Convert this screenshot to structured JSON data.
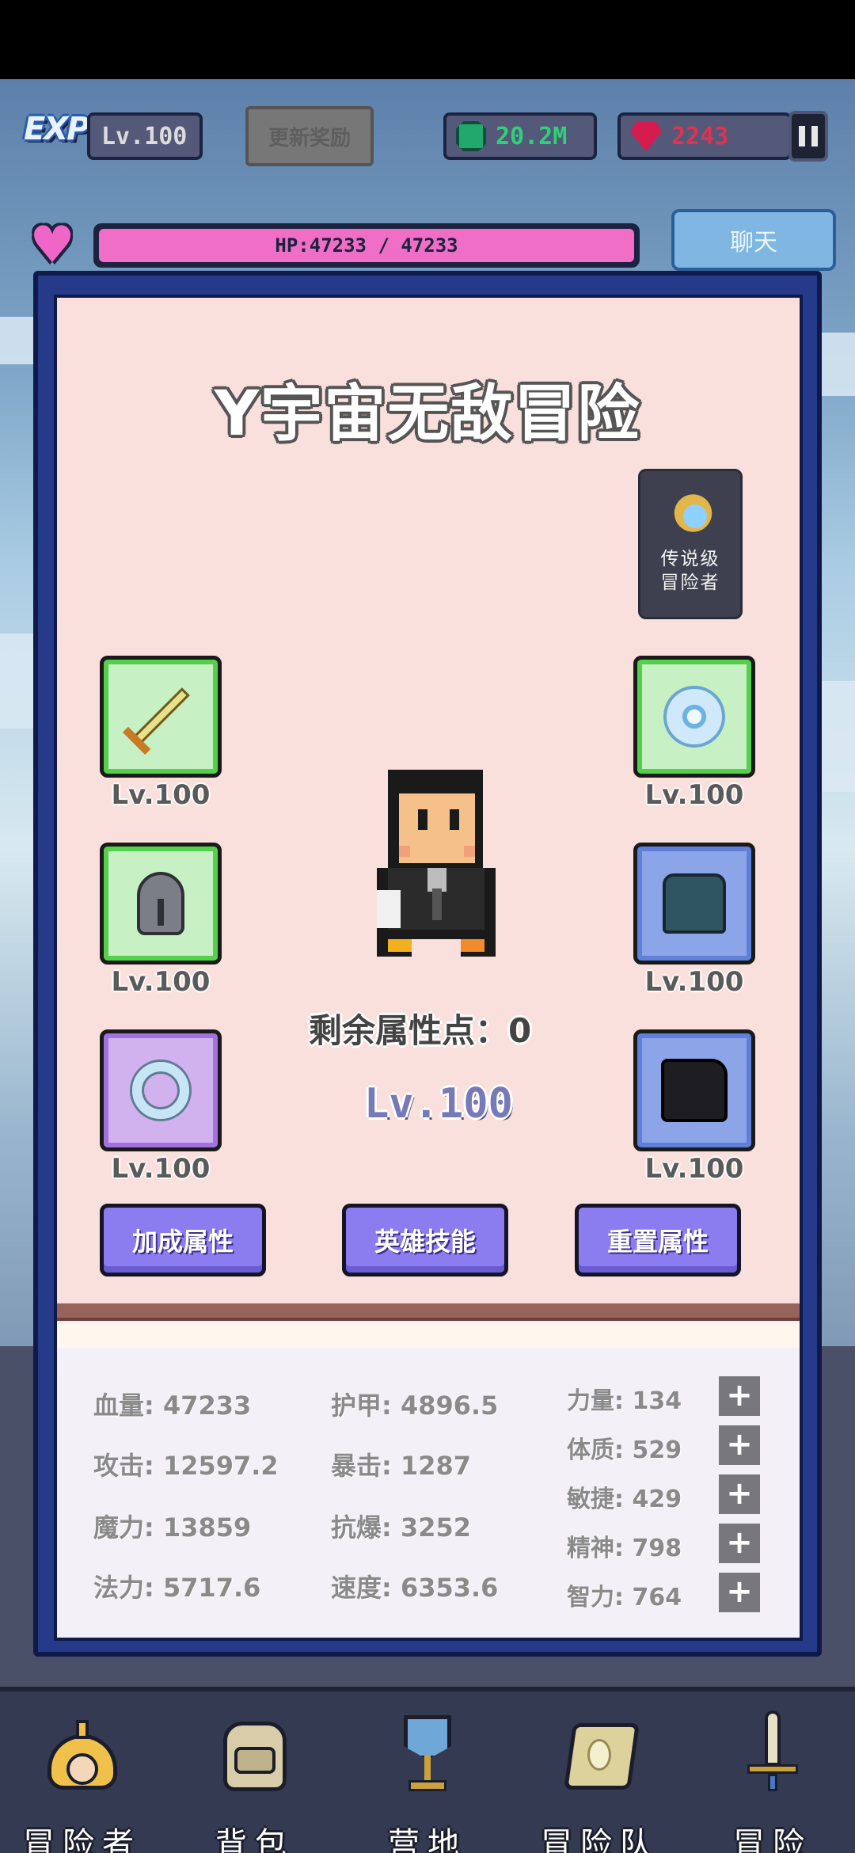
{
  "hud": {
    "exp_logo": "EXP",
    "level": "Lv.100",
    "update_reward": "更新奖励",
    "gems": "20.2M",
    "rubies": "2243",
    "hp_text": "HP:47233 / 47233",
    "chat_label": "聊天"
  },
  "hero": {
    "title": "Y宇宙无敌冒险",
    "badge_line1": "传说级",
    "badge_line2": "冒险者",
    "attr_points": "剩余属性点：0",
    "level": "Lv.100"
  },
  "equipment": [
    {
      "name": "sword",
      "level": "Lv.100",
      "rarity": "green"
    },
    {
      "name": "orb",
      "level": "Lv.100",
      "rarity": "green"
    },
    {
      "name": "helmet",
      "level": "Lv.100",
      "rarity": "green"
    },
    {
      "name": "armor",
      "level": "Lv.100",
      "rarity": "blue"
    },
    {
      "name": "ring",
      "level": "Lv.100",
      "rarity": "purple"
    },
    {
      "name": "boots",
      "level": "Lv.100",
      "rarity": "blue"
    }
  ],
  "actions": {
    "bonus_attrs": "加成属性",
    "hero_skills": "英雄技能",
    "reset_attrs": "重置属性"
  },
  "stats": {
    "col1": [
      "血量: 47233",
      "攻击: 12597.2",
      "魔力: 13859",
      "法力: 5717.6"
    ],
    "col2": [
      "护甲: 4896.5",
      "暴击: 1287",
      "抗爆: 3252",
      "速度: 6353.6"
    ],
    "col3": [
      "力量: 134",
      "体质: 529",
      "敏捷: 429",
      "精神: 798",
      "智力: 764"
    ],
    "plus": "+"
  },
  "nav": {
    "adventurer": "冒险者",
    "backpack": "背包",
    "camp": "营地",
    "party": "冒险队",
    "adventure": "冒险"
  },
  "colors": {
    "panel_border": "#263a8a",
    "hero_bg": "#fae0dd",
    "hp_fill": "#f06ec6",
    "button": "#8b7cef"
  }
}
